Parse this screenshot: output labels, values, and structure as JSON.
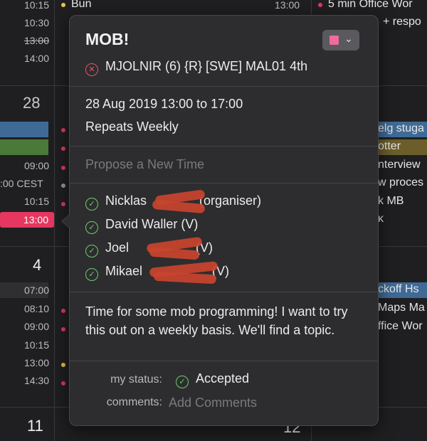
{
  "calendar": {
    "day_numbers": [
      "28",
      "4",
      "11",
      "12"
    ],
    "times": [
      "10:15",
      "10:30",
      "13:00",
      "14:00",
      "09:00",
      ":00 CEST",
      "10:15",
      "13:00",
      "07:00",
      "08:10",
      "09:00",
      "10:15",
      "13:00",
      "14:30"
    ],
    "events_left": [
      "Bun",
      "13:00"
    ],
    "events_right": [
      "5 min Office Wor",
      "+ respo",
      "elg stuga",
      "otter",
      "nterview",
      "w proces",
      "k MB",
      "κ",
      "ckoff Hs",
      "Maps Ma",
      "ffice Wor"
    ]
  },
  "popover": {
    "title": "MOB!",
    "location": "MJOLNIR (6) {R} [SWE] MAL01 4th",
    "date_time": "28 Aug 2019  13:00 to 17:00",
    "repeat": "Repeats Weekly",
    "propose": "Propose a New Time",
    "attendees": [
      {
        "name": "Nicklas",
        "suffix": "(organiser)"
      },
      {
        "name": "David Waller (V)",
        "suffix": ""
      },
      {
        "name": "Joel",
        "suffix": "(V)"
      },
      {
        "name": "Mikael",
        "suffix": "(V)"
      }
    ],
    "description": "Time for some mob programming! I want to try this out on a weekly basis. We'll find a topic.",
    "status_label": "my status:",
    "status_value": "Accepted",
    "comments_label": "comments:",
    "comments_placeholder": "Add Comments",
    "color": "#f06c9a"
  }
}
